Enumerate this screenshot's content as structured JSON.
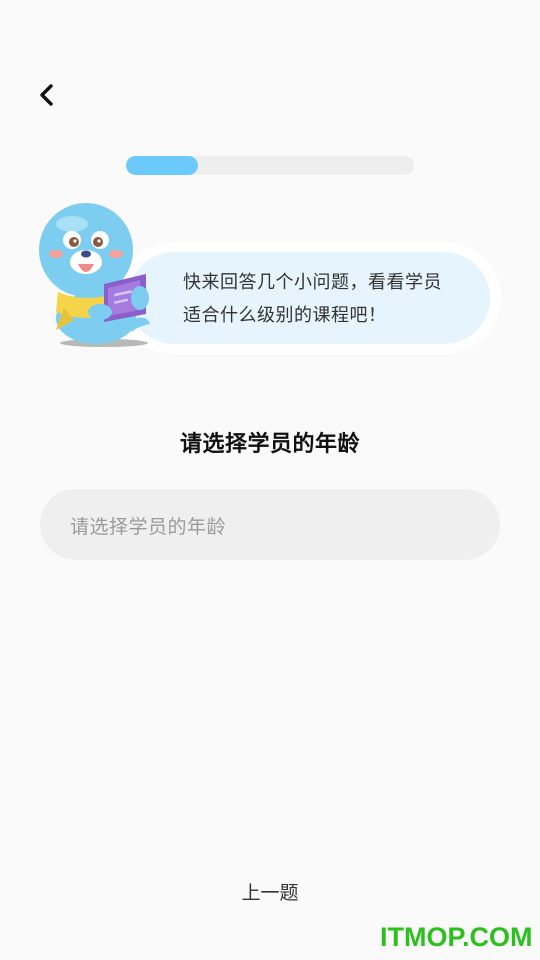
{
  "header": {
    "back_icon": "chevron-left-icon"
  },
  "progress": {
    "fraction": 0.25,
    "fill_color": "#6cc9fb",
    "track_color": "#eeeeee"
  },
  "mascot": {
    "icon": "seal-mascot-reading-book"
  },
  "speech_bubble": {
    "line1": "快来回答几个小问题，看看学员",
    "line2": "适合什么级别的课程吧！"
  },
  "question": {
    "title": "请选择学员的年龄"
  },
  "age_select": {
    "placeholder": "请选择学员的年龄"
  },
  "footer": {
    "prev_label": "上一题"
  },
  "watermark": {
    "text": "ITMOP.COM",
    "color": "#2cc01e"
  }
}
